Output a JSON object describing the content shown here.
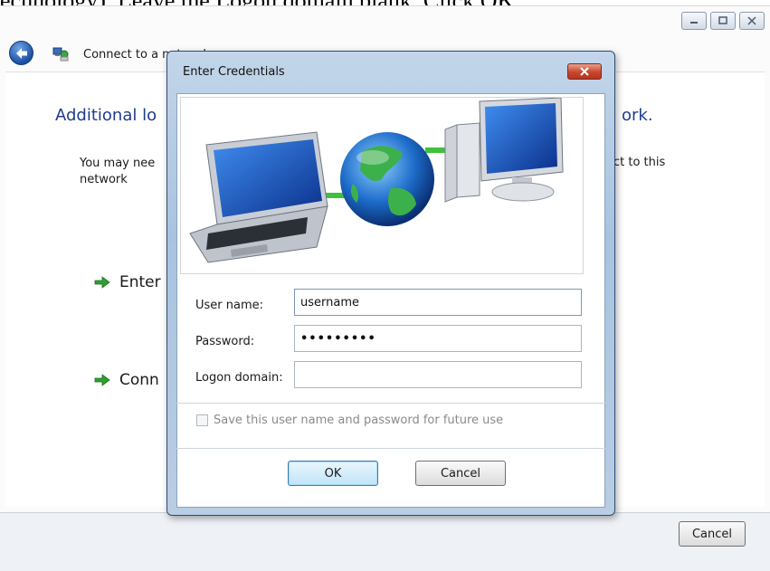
{
  "document_crop_text": "echnology). Leave the Logon domain blank. Click OK.",
  "window": {
    "nav_title": "Connect to a network",
    "heading_left": "Additional lo",
    "heading_right": "ork.",
    "description_left_line1": "You may nee",
    "description_left_line2": "network",
    "description_right": "ct to this",
    "option1_label": "Enter",
    "option2_label": "Conn",
    "cancel_label": "Cancel"
  },
  "dialog": {
    "title": "Enter Credentials",
    "username_label": "User name:",
    "username_value": "username",
    "password_label": "Password:",
    "password_value": "•••••••••",
    "domain_label": "Logon domain:",
    "domain_value": "",
    "save_checkbox_label": "Save this user name and password for future use",
    "save_checked": false,
    "ok_label": "OK",
    "cancel_label": "Cancel"
  },
  "colors": {
    "heading": "#1e3c8c",
    "dialog_frame": "#b9cde4",
    "close_button": "#c9452c",
    "link_arrow": "#2fa02f"
  },
  "icons": {
    "back": "back-arrow-icon",
    "network": "network-icon",
    "minimize": "minimize-icon",
    "maximize": "maximize-icon",
    "close": "close-icon",
    "option_arrow": "green-arrow-icon"
  }
}
